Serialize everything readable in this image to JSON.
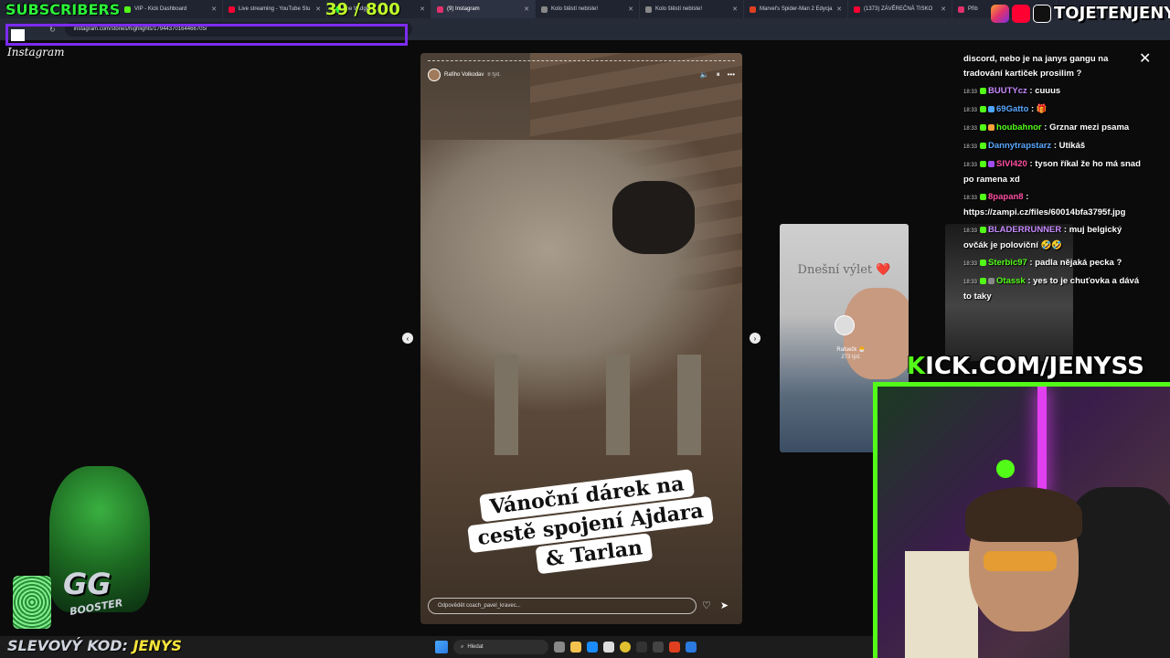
{
  "overlay": {
    "subscribers_label": "SUBSCRIBERS",
    "sub_count": "39 / 800",
    "brand_name": "TOJETENJENYS",
    "kick_url_prefix": "K",
    "kick_url": "ICK.COM/JENYSS",
    "promo_label": "SLEVOVÝ KOD:",
    "promo_code": "JENYS",
    "mascot_text": "GG",
    "mascot_sub": "BOOSTER"
  },
  "browser": {
    "tabs": [
      {
        "label": "VIP - Kick Dashboard",
        "color": "#53fc18"
      },
      {
        "label": "Live streaming - YouTube Stu",
        "color": "#ff0033"
      },
      {
        "label": "The Widget",
        "color": "#2cf23a"
      },
      {
        "label": "(9) Instagram",
        "color": "#e1306c",
        "active": true
      },
      {
        "label": "Kolo štěstí nebíste!",
        "color": "#888888"
      },
      {
        "label": "Kolo štěstí nebíste!",
        "color": "#888888"
      },
      {
        "label": "Marvel's Spider-Man 2 Edycja",
        "color": "#e04020"
      },
      {
        "label": "(1373) ZÁVĚREČNÁ TISKO",
        "color": "#ff0033"
      },
      {
        "label": "Přib",
        "color": "#e1306c"
      }
    ],
    "url": "instagram.com/stories/highlights/17944370164466705/",
    "logo": "Instagram"
  },
  "story": {
    "username": "Rafiho Volkodav",
    "time": "8 týd.",
    "caption_lines": [
      "Vánoční dárek na",
      "cestě spojení Ajdara",
      "& Tarlan"
    ],
    "reply_placeholder": "Odpovědět coach_pavel_kravec..."
  },
  "next_story": {
    "title": "Dnešní výlet ❤️",
    "username": "Rafuečk 🐣",
    "time": "273 týd."
  },
  "chat": [
    {
      "user": "",
      "user_color": "#ffffff",
      "text": "discord, nebo je na janys gangu na tradování kartiček prosilim ?"
    },
    {
      "time": "18:33",
      "user": "BUUTYcz",
      "user_color": "#c78bff",
      "text": " : cuuus"
    },
    {
      "time": "18:33",
      "user": "69Gatto",
      "user_color": "#5aa8ff",
      "text": " : 🎁"
    },
    {
      "time": "18:33",
      "user": "houbahnor",
      "user_color": "#53fc18",
      "text": " : Grznar mezi psama"
    },
    {
      "time": "18:33",
      "user": "Dannytrapstarz",
      "user_color": "#5aa8ff",
      "text": " : Utíkáš"
    },
    {
      "time": "18:33",
      "user": "SIVI420",
      "user_color": "#ff4fa3",
      "text": " : tyson říkal že ho má snad po ramena xd"
    },
    {
      "time": "18:33",
      "user": "8papan8",
      "user_color": "#ff4fa3",
      "text": " : https://zampi.cz/files/60014bfa3795f.jpg"
    },
    {
      "time": "18:33",
      "user": "BLADERRUNNER",
      "user_color": "#c78bff",
      "text": " : muj belgický ovčák je poloviční 🤣🤣"
    },
    {
      "time": "18:33",
      "user": "Sterbic97",
      "user_color": "#53fc18",
      "text": " : padla nějaká pecka ?"
    },
    {
      "time": "18:33",
      "user": "Otassk",
      "user_color": "#53fc18",
      "text": " : yes to je chuťovka a dává to taky"
    }
  ],
  "taskbar": {
    "search_placeholder": "Hledat"
  }
}
